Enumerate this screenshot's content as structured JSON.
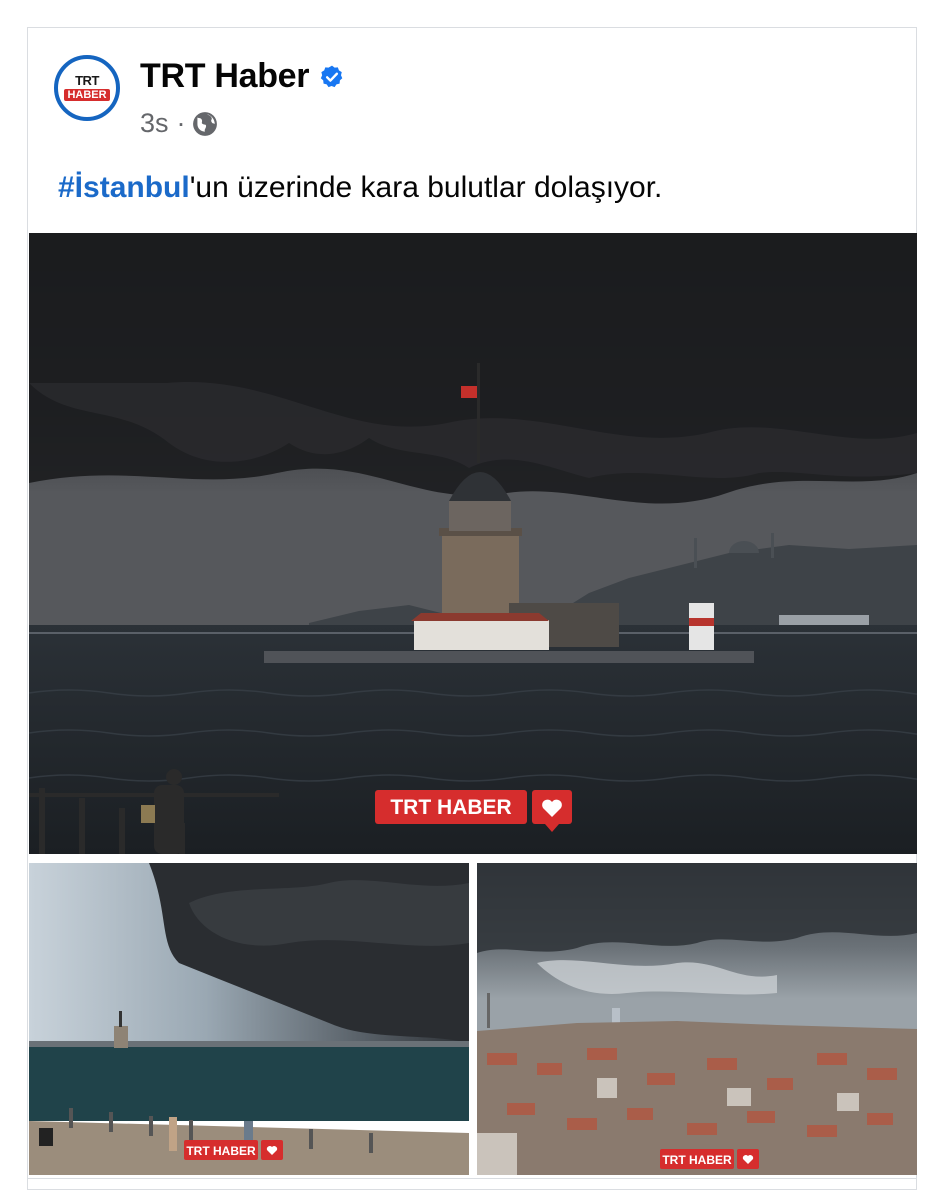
{
  "post": {
    "page_name": "TRT Haber",
    "avatar_text_top": "TRT",
    "avatar_text_bottom": "HABER",
    "timestamp": "3s",
    "separator": "·",
    "audience_icon": "globe-icon",
    "verified_icon": "verified-badge-icon",
    "hashtag": "#İstanbul",
    "text_rest": "'un üzerinde kara bulutlar dolaşıyor.",
    "watermark": "TRT HABER",
    "colors": {
      "link": "#1b6ac9",
      "accent": "#1565c0",
      "brand_red": "#d62d2d"
    }
  }
}
